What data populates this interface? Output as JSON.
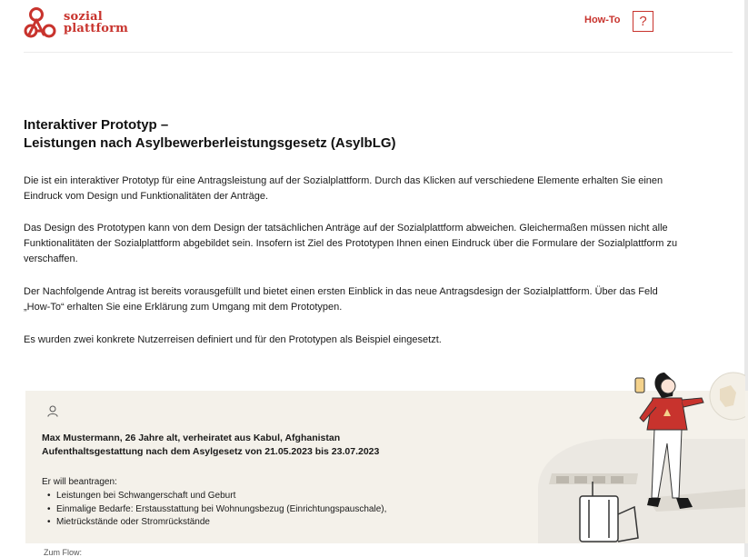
{
  "header": {
    "logo_line1": "sozial",
    "logo_line2": "plattform",
    "howto_label": "How-To",
    "help_label": "?"
  },
  "main": {
    "title_line1": "Interaktiver Prototyp –",
    "title_line2": "Leistungen nach Asylbewerberleistungsgesetz (AsylbLG)",
    "paragraphs": [
      "Die ist ein interaktiver Prototyp für eine Antragsleistung auf der Sozialplattform. Durch das Klicken auf verschiedene Elemente erhalten Sie einen Eindruck vom Design und Funktionalitäten der Anträge.",
      "Das Design des Prototypen kann von dem Design der tatsächlichen Anträge auf der Sozialplattform abweichen. Gleichermaßen müssen nicht alle Funktionalitäten der Sozialplattform abgebildet sein. Insofern ist Ziel des Prototypen Ihnen einen Eindruck über die Formulare der Sozialplattform zu verschaffen.",
      "Der Nachfolgende Antrag ist bereits vorausgefüllt und bietet einen ersten Einblick in das neue Antragsdesign der Sozialplattform. Über das Feld „How-To“ erhalten Sie eine Erklärung zum Umgang mit dem Prototypen.",
      "Es wurden zwei konkrete Nutzerreisen definiert und für den Prototypen als Beispiel eingesetzt."
    ]
  },
  "journey": {
    "persona_line1": "Max Mustermann, 26 Jahre alt, verheiratet aus Kabul, Afghanistan",
    "persona_line2": "Aufenthaltsgestattung nach dem Asylgesetz von 21.05.2023 bis 23.07.2023",
    "wants_label": "Er will beantragen:",
    "bullets": [
      "Leistungen bei Schwangerschaft und Geburt",
      "Einmalige Bedarfe: Erstausstattung bei Wohnungsbezug (Einrichtungspauschale),",
      "Mietrückstände oder Stromrückstände"
    ],
    "flow_label": "Zum Flow:"
  },
  "colors": {
    "brand_red": "#c8332d",
    "journey_bg": "#f4f1ea"
  }
}
